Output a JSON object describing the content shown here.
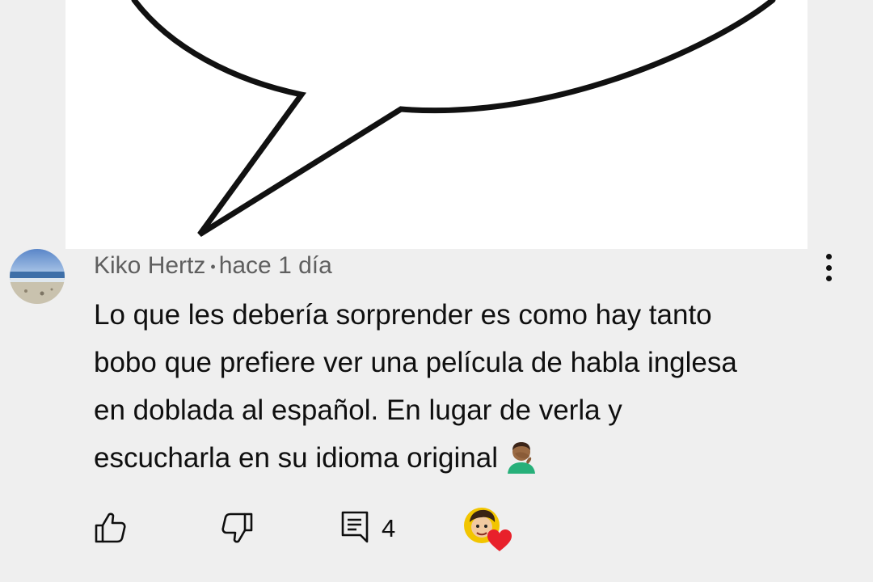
{
  "comment": {
    "author": "Kiko Hertz",
    "separator": "•",
    "time": "hace 1 día",
    "lines": [
      "Lo que les debería sorprender es como hay tanto",
      "bobo que prefiere ver una película de habla inglesa",
      "en doblada al español. En lugar de verla y",
      "escucharla en su idioma original"
    ],
    "emoji": "man-facepalming-emoji"
  },
  "actions": {
    "reply_count": "4"
  },
  "icons": {
    "like": "thumb-up-icon",
    "dislike": "thumb-down-icon",
    "reply": "comment-icon",
    "more": "more-vertical-icon",
    "creator_heart": "creator-heart-icon"
  },
  "colors": {
    "background": "#efefef",
    "text": "#0f0f0f",
    "meta_text": "#5f5f5f",
    "heart": "#e8212b"
  }
}
